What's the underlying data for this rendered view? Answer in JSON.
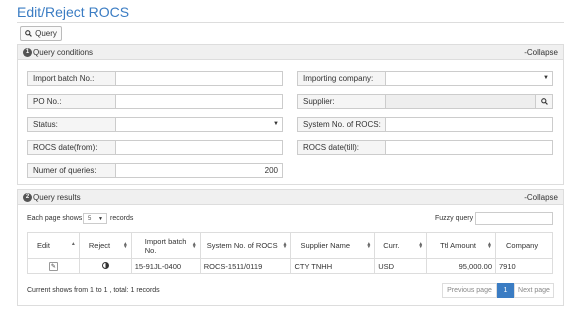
{
  "page": {
    "title": "Edit/Reject ROCS"
  },
  "toolbar": {
    "query_label": "Query"
  },
  "query_panel": {
    "number": "1",
    "title": "Query conditions",
    "collapse_label": "-Collapse",
    "fields": {
      "import_batch_no": {
        "label": "Import batch No.:",
        "value": ""
      },
      "importing_company": {
        "label": "Importing company:",
        "value": ""
      },
      "po_no": {
        "label": "PO No.:",
        "value": ""
      },
      "supplier": {
        "label": "Supplier:",
        "value": ""
      },
      "status": {
        "label": "Status:",
        "value": ""
      },
      "system_no_rocs": {
        "label": "System No. of ROCS:",
        "value": ""
      },
      "rocs_date_from": {
        "label": "ROCS date(from):",
        "value": ""
      },
      "rocs_date_till": {
        "label": "ROCS date(till):",
        "value": ""
      },
      "num_queries": {
        "label": "Numer of queries:",
        "value": "200"
      }
    }
  },
  "results_panel": {
    "number": "2",
    "title": "Query results",
    "collapse_label": "-Collapse",
    "page_size_prefix": "Each page shows",
    "page_size_value": "5",
    "page_size_suffix": "records",
    "fuzzy_label": "Fuzzy query",
    "fuzzy_value": "",
    "columns": [
      "Edit",
      "Reject",
      "Import batch No.",
      "System No. of ROCS",
      "Supplier Name",
      "Curr.",
      "Ttl Amount",
      "Company"
    ],
    "rows": [
      {
        "import_batch_no": "15-91JL-0400",
        "system_no": "ROCS-1511/0119",
        "supplier_name": "CTY TNHH",
        "currency": "USD",
        "ttl_amount": "95,000.00",
        "company": "7910"
      }
    ],
    "footer_text": "Current shows from 1 to 1 , total: 1 records",
    "pager": {
      "prev_label": "Previous page",
      "current_page": "1",
      "next_label": "Next page"
    }
  },
  "colors": {
    "accent": "#3a7cc3",
    "link_orange": "#e8a24a"
  }
}
